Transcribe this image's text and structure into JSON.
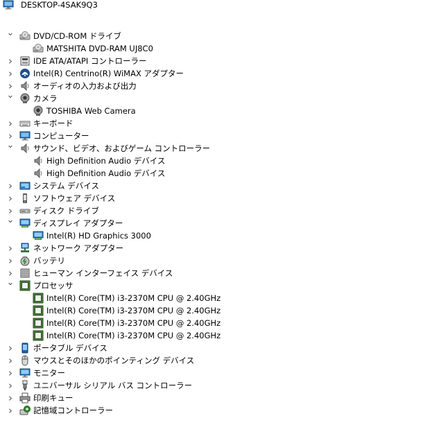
{
  "tree": {
    "root": "DESKTOP-4SAK9Q3",
    "nodes": [
      {
        "label": "DVD/CD-ROM ドライブ",
        "icon": "dvd-drive-icon",
        "expanded": true,
        "children": [
          {
            "label": "MATSHITA DVD-RAM UJ8C0",
            "icon": "dvd-drive-icon"
          }
        ]
      },
      {
        "label": "IDE ATA/ATAPI コントローラー",
        "icon": "ide-controller-icon",
        "expanded": false
      },
      {
        "label": "Intel(R) Centrino(R) WiMAX アダプター",
        "icon": "wimax-icon",
        "expanded": false
      },
      {
        "label": "オーディオの入力および出力",
        "icon": "speaker-icon",
        "expanded": false
      },
      {
        "label": "カメラ",
        "icon": "camera-icon",
        "expanded": true,
        "children": [
          {
            "label": "TOSHIBA Web Camera",
            "icon": "camera-icon"
          }
        ]
      },
      {
        "label": "キーボード",
        "icon": "keyboard-icon",
        "expanded": false
      },
      {
        "label": "コンピューター",
        "icon": "computer-icon",
        "expanded": false
      },
      {
        "label": "サウンド、ビデオ、およびゲーム コントローラー",
        "icon": "speaker-icon",
        "expanded": true,
        "children": [
          {
            "label": "High Definition Audio デバイス",
            "icon": "speaker-icon"
          },
          {
            "label": "High Definition Audio デバイス",
            "icon": "speaker-icon"
          }
        ]
      },
      {
        "label": "システム デバイス",
        "icon": "system-device-icon",
        "expanded": false
      },
      {
        "label": "ソフトウェア デバイス",
        "icon": "software-device-icon",
        "expanded": false
      },
      {
        "label": "ディスク ドライブ",
        "icon": "disk-drive-icon",
        "expanded": false
      },
      {
        "label": "ディスプレイ アダプター",
        "icon": "display-adapter-icon",
        "expanded": true,
        "children": [
          {
            "label": "Intel(R) HD Graphics 3000",
            "icon": "display-adapter-icon"
          }
        ]
      },
      {
        "label": "ネットワーク アダプター",
        "icon": "network-adapter-icon",
        "expanded": false
      },
      {
        "label": "バッテリ",
        "icon": "battery-icon",
        "expanded": false
      },
      {
        "label": "ヒューマン インターフェイス デバイス",
        "icon": "hid-icon",
        "expanded": false
      },
      {
        "label": "プロセッサ",
        "icon": "processor-icon",
        "expanded": true,
        "children": [
          {
            "label": "Intel(R) Core(TM) i3-2370M CPU @ 2.40GHz",
            "icon": "processor-icon"
          },
          {
            "label": "Intel(R) Core(TM) i3-2370M CPU @ 2.40GHz",
            "icon": "processor-icon"
          },
          {
            "label": "Intel(R) Core(TM) i3-2370M CPU @ 2.40GHz",
            "icon": "processor-icon"
          },
          {
            "label": "Intel(R) Core(TM) i3-2370M CPU @ 2.40GHz",
            "icon": "processor-icon"
          }
        ]
      },
      {
        "label": "ポータブル デバイス",
        "icon": "portable-device-icon",
        "expanded": false
      },
      {
        "label": "マウスとそのほかのポインティング デバイス",
        "icon": "mouse-icon",
        "expanded": false
      },
      {
        "label": "モニター",
        "icon": "monitor-icon",
        "expanded": false
      },
      {
        "label": "ユニバーサル シリアル バス コントローラー",
        "icon": "usb-icon",
        "expanded": false
      },
      {
        "label": "印刷キュー",
        "icon": "printer-icon",
        "expanded": false
      },
      {
        "label": "記憶域コントローラー",
        "icon": "storage-controller-icon",
        "expanded": false
      }
    ]
  }
}
